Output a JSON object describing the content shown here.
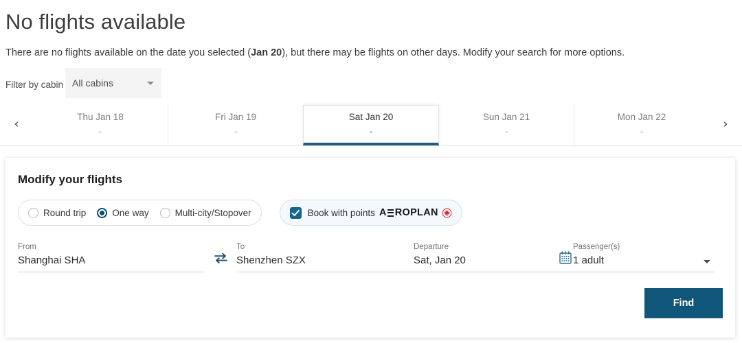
{
  "page": {
    "title": "No flights available",
    "subtitle_before": "There are no flights available on the date you selected (",
    "subtitle_bold": "Jan 20",
    "subtitle_after": "), but there may be flights on other days. Modify your search for more options."
  },
  "filter": {
    "label": "Filter by cabin",
    "selected": "All cabins"
  },
  "date_strip": {
    "prev_icon": "‹",
    "next_icon": "›",
    "tabs": [
      {
        "label": "Thu Jan 18",
        "price": "-",
        "selected": false
      },
      {
        "label": "Fri Jan 19",
        "price": "-",
        "selected": false
      },
      {
        "label": "Sat Jan 20",
        "price": "-",
        "selected": true
      },
      {
        "label": "Sun Jan 21",
        "price": "-",
        "selected": false
      },
      {
        "label": "Mon Jan 22",
        "price": "-",
        "selected": false
      }
    ]
  },
  "modify": {
    "title": "Modify your flights",
    "trip_types": [
      {
        "label": "Round trip",
        "selected": false
      },
      {
        "label": "One way",
        "selected": true
      },
      {
        "label": "Multi-city/Stopover",
        "selected": false
      }
    ],
    "points": {
      "label": "Book with points",
      "brand": "AEROPLAN",
      "checked": true
    },
    "fields": {
      "from_label": "From",
      "from_value": "Shanghai SHA",
      "to_label": "To",
      "to_value": "Shenzhen SZX",
      "departure_label": "Departure",
      "departure_value": "Sat, Jan 20",
      "passengers_label": "Passenger(s)",
      "passengers_value": "1 adult"
    },
    "find_label": "Find"
  },
  "colors": {
    "accent": "#10557a",
    "tab_underline": "#1b5e82",
    "maple_red": "#d42e2e"
  }
}
